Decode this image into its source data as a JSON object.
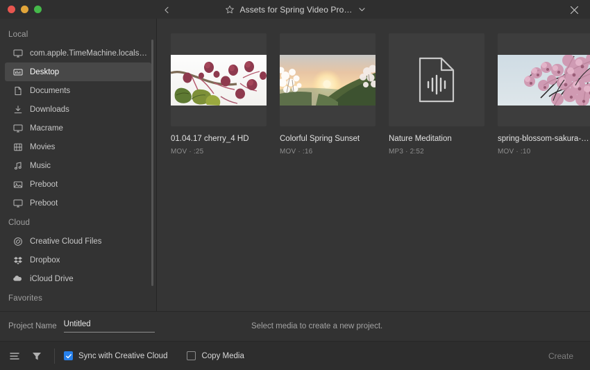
{
  "window": {
    "traffic_lights": [
      "close",
      "minimize",
      "zoom"
    ],
    "colors": {
      "close": "#e8564f",
      "minimize": "#e2a53a",
      "zoom": "#45b94a",
      "accent": "#2680eb",
      "selection": "#484848",
      "background": "#353535",
      "sidebar_bg": "#333333"
    },
    "back_icon": "chevron-left-icon",
    "favorite_icon": "star-outline-icon",
    "title": "Assets for Spring Video Pro…",
    "title_dropdown_icon": "chevron-down-icon",
    "close_icon": "close-x-icon"
  },
  "sidebar": {
    "sections": [
      {
        "label": "Local",
        "items": [
          {
            "label": "com.apple.TimeMachine.localsnapshots",
            "icon": "monitor-icon",
            "selected": false
          },
          {
            "label": "Desktop",
            "icon": "desktop-icon",
            "selected": true
          },
          {
            "label": "Documents",
            "icon": "document-icon",
            "selected": false
          },
          {
            "label": "Downloads",
            "icon": "download-icon",
            "selected": false
          },
          {
            "label": "Macrame",
            "icon": "monitor-icon",
            "selected": false
          },
          {
            "label": "Movies",
            "icon": "film-icon",
            "selected": false
          },
          {
            "label": "Music",
            "icon": "music-note-icon",
            "selected": false
          },
          {
            "label": "Preboot",
            "icon": "monitor-icon",
            "selected": false
          }
        ]
      },
      {
        "label": "Cloud",
        "items": [
          {
            "label": "Creative Cloud Files",
            "icon": "creative-cloud-icon",
            "selected": false
          },
          {
            "label": "Dropbox",
            "icon": "dropbox-icon",
            "selected": false
          },
          {
            "label": "iCloud Drive",
            "icon": "cloud-icon",
            "selected": false
          }
        ]
      },
      {
        "label": "Favorites",
        "items": []
      }
    ]
  },
  "media": {
    "items": [
      {
        "title": "01.04.17 cherry_4 HD",
        "meta": "MOV · :25",
        "format": "MOV",
        "duration": ":25",
        "thumb": "cherry-buds-photo"
      },
      {
        "title": "Colorful Spring Sunset",
        "meta": "MOV · :16",
        "format": "MOV",
        "duration": ":16",
        "thumb": "spring-sunset-photo"
      },
      {
        "title": "Nature Meditation",
        "meta": "MP3 · 2:52",
        "format": "MP3",
        "duration": "2:52",
        "thumb": "audio-file-icon"
      },
      {
        "title": "spring-blossom-sakura-Z7Q…",
        "meta": "MOV · :10",
        "format": "MOV",
        "duration": ":10",
        "thumb": "sakura-blossom-photo"
      }
    ]
  },
  "project_bar": {
    "label": "Project Name",
    "value": "Untitled",
    "placeholder": "Untitled",
    "hint": "Select media to create a new project."
  },
  "bottom_bar": {
    "list_view_icon": "list-view-icon",
    "filter_icon": "filter-funnel-icon",
    "checkboxes": [
      {
        "label": "Sync with Creative Cloud",
        "checked": true
      },
      {
        "label": "Copy Media",
        "checked": false
      }
    ],
    "create_label": "Create",
    "create_enabled": false
  }
}
